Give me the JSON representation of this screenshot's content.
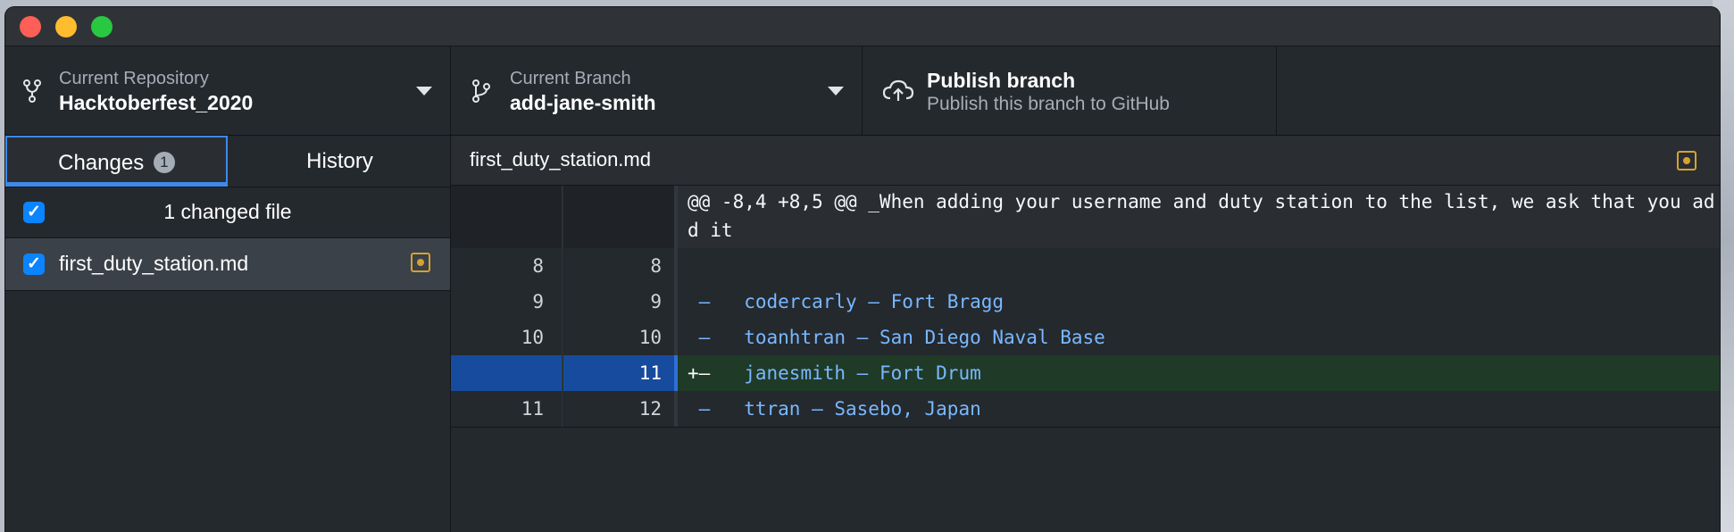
{
  "window": {
    "title": ""
  },
  "toolbar": {
    "repo_label": "Current Repository",
    "repo_value": "Hacktoberfest_2020",
    "branch_label": "Current Branch",
    "branch_value": "add-jane-smith",
    "publish_title": "Publish branch",
    "publish_sub": "Publish this branch to GitHub"
  },
  "sidebar": {
    "tabs": [
      {
        "label": "Changes",
        "badge": "1"
      },
      {
        "label": "History"
      }
    ],
    "summary": "1 changed file",
    "files": [
      {
        "name": "first_duty_station.md",
        "status": "modified"
      }
    ]
  },
  "diff": {
    "file_title": "first_duty_station.md",
    "hunk": "@@ -8,4 +8,5 @@ _When adding your username and duty station to the list, we ask that you add it",
    "lines": [
      {
        "old": "8",
        "new": "8",
        "prefix": "",
        "text": ""
      },
      {
        "old": "9",
        "new": "9",
        "prefix": " –",
        "text": "   codercarly – Fort Bragg"
      },
      {
        "old": "10",
        "new": "10",
        "prefix": " –",
        "text": "   toanhtran – San Diego Naval Base"
      },
      {
        "old": "",
        "new": "11",
        "prefix": "+–",
        "text": "   janesmith – Fort Drum"
      },
      {
        "old": "11",
        "new": "12",
        "prefix": " –",
        "text": "   ttran – Sasebo, Japan"
      }
    ]
  },
  "colors": {
    "accent": "#3d8aea",
    "modified": "#d7a22f",
    "added_bg": "#1f3a27",
    "added_gutter": "#174b9e",
    "code_text": "#79b8ff"
  }
}
